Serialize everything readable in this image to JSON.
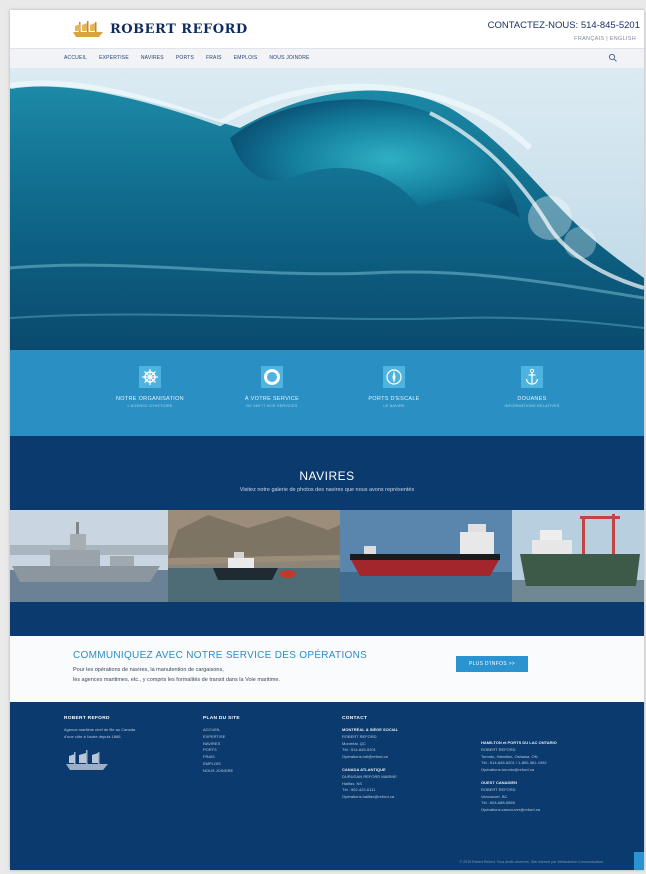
{
  "header": {
    "brand": "ROBERT REFORD",
    "contact_phone": "CONTACTEZ-NOUS: 514-845-5201",
    "languages": "FRANÇAIS | ENGLISH"
  },
  "nav": {
    "items": [
      "ACCUEIL",
      "EXPERTISE",
      "NAVIRES",
      "PORTS",
      "FRAIS",
      "EMPLOIS",
      "NOUS JOINDRE"
    ]
  },
  "services": [
    {
      "title": "NOTRE ORGANISATION",
      "sub": "L'AGENCE D'HISTOIRE",
      "icon": "ship-wheel-icon"
    },
    {
      "title": "À VOTRE SERVICE",
      "sub": "DE 360°/7 NOS SERVICES",
      "icon": "lifebuoy-icon"
    },
    {
      "title": "PORTS D'ESCALE",
      "sub": "LE NAVIRE",
      "icon": "compass-icon"
    },
    {
      "title": "DOUANES",
      "sub": "INFORMATIONS RELATIVES",
      "icon": "anchor-icon"
    }
  ],
  "vessels": {
    "title": "NAVIRES",
    "subtitle": "Visitez notre galerie de photos des navires que nous avons représentés"
  },
  "cta": {
    "title": "COMMUNIQUEZ AVEC NOTRE SERVICE DES OPÉRATIONS",
    "line1": "Pour les opérations de navires, la manutention de cargaisons,",
    "line2": "les agences maritimes, etc., y compris les formalités de transit dans la Voie maritime.",
    "button": "PLUS D'INFOS >>"
  },
  "footer": {
    "about": {
      "heading": "ROBERT REFORD",
      "line1": "Agence maritime chef de file au Canada",
      "line2": "d'une côte à l'autre depuis 1866."
    },
    "sitemap": {
      "heading": "PLAN DU SITE",
      "items": [
        "ACCUEIL",
        "EXPERTISE",
        "NAVIRES",
        "PORTS",
        "FRAIS",
        "EMPLOIS",
        "NOUS JOINDRE"
      ]
    },
    "contact": {
      "heading": "CONTACT",
      "montreal_heading": "MONTRÉAL & SIÈGE SOCIAL",
      "montreal_lines": [
        "ROBERT REFORD",
        "Montréal, QC",
        "Tél.: 514-845-5201",
        "Opérations.mtl@reford.ca"
      ],
      "atlantic_heading": "CANADA ATLANTIQUE",
      "atlantic_lines": [
        "DURUGAN REFORD MARINE",
        "Halifax, NS",
        "Tél.: 902-422-6111",
        "Opérations.halifax@reford.ca"
      ]
    },
    "offices": {
      "hamilton_heading": "HAMILTON et PORTS DU LAC ONTARIO",
      "hamilton_lines": [
        "ROBERT REFORD",
        "Toronto, Hamilton, Oshawa, ON",
        "Tél.: 514-845-5201 / 1-800-361-1992",
        "Opérations.toronto@reford.ca"
      ],
      "west_heading": "OUEST CANADIEN",
      "west_lines": [
        "ROBERT REFORD",
        "Vancouver, BC",
        "Tél.: 604-688-5569",
        "Opérations.vancouver@reford.ca"
      ]
    },
    "copyright": "© 2015 Robert Reford. Tous droits réservés. Site Internet par Websolution Communication."
  },
  "colors": {
    "navy": "#0b3a6e",
    "accent_blue": "#2b93cf",
    "band_blue": "#2a8fc2"
  }
}
